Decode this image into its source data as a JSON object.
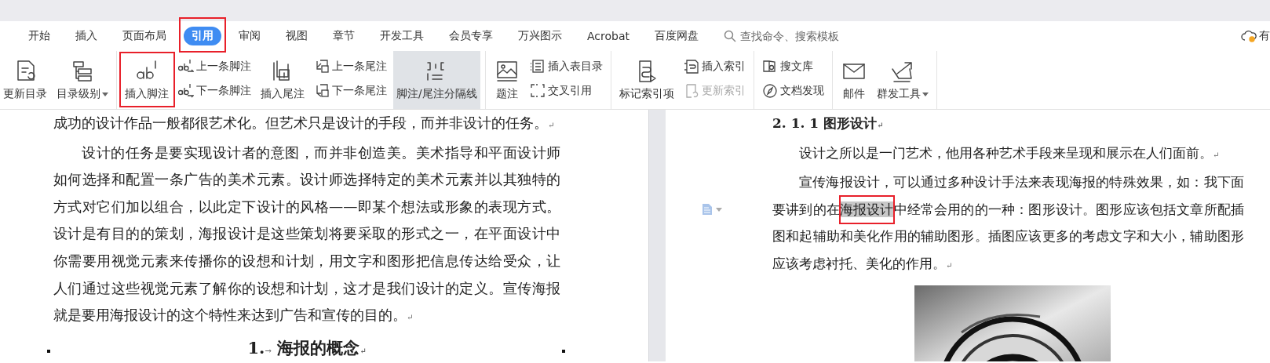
{
  "menu": {
    "tabs": [
      {
        "label": "开始",
        "selected": false,
        "annotated": false
      },
      {
        "label": "插入",
        "selected": false,
        "annotated": false
      },
      {
        "label": "页面布局",
        "selected": false,
        "annotated": false
      },
      {
        "label": "引用",
        "selected": true,
        "annotated": true
      },
      {
        "label": "审阅",
        "selected": false,
        "annotated": false
      },
      {
        "label": "视图",
        "selected": false,
        "annotated": false
      },
      {
        "label": "章节",
        "selected": false,
        "annotated": false
      },
      {
        "label": "开发工具",
        "selected": false,
        "annotated": false
      },
      {
        "label": "会员专享",
        "selected": false,
        "annotated": false
      },
      {
        "label": "万兴图示",
        "selected": false,
        "annotated": false
      },
      {
        "label": "Acrobat",
        "selected": false,
        "annotated": false
      },
      {
        "label": "百度网盘",
        "selected": false,
        "annotated": false
      }
    ],
    "search": {
      "placeholder": "查找命令、搜索模板"
    },
    "account": {
      "label": "有"
    }
  },
  "ribbon": {
    "groups": [
      {
        "items": [
          {
            "kind": "large",
            "label": "更新目录",
            "dropdown": false,
            "annotated": false,
            "hovered": false
          },
          {
            "kind": "large",
            "label": "目录级别",
            "dropdown": true,
            "annotated": false,
            "hovered": false
          }
        ]
      },
      {
        "items": [
          {
            "kind": "large",
            "label": "插入脚注",
            "dropdown": false,
            "annotated": true,
            "hovered": false
          },
          {
            "kind": "pair",
            "items": [
              {
                "label": "上一条脚注",
                "disabled": false
              },
              {
                "label": "下一条脚注",
                "disabled": false
              }
            ]
          },
          {
            "kind": "large",
            "label": "插入尾注",
            "dropdown": false,
            "annotated": false,
            "hovered": false
          },
          {
            "kind": "pair",
            "items": [
              {
                "label": "上一条尾注",
                "disabled": false
              },
              {
                "label": "下一条尾注",
                "disabled": false
              }
            ]
          },
          {
            "kind": "large",
            "label": "脚注/尾注分隔线",
            "dropdown": false,
            "annotated": false,
            "hovered": true
          }
        ]
      },
      {
        "items": [
          {
            "kind": "large",
            "label": "题注",
            "dropdown": false,
            "annotated": false,
            "hovered": false
          },
          {
            "kind": "pair",
            "items": [
              {
                "label": "插入表目录",
                "disabled": false
              },
              {
                "label": "交叉引用",
                "disabled": false
              }
            ]
          }
        ]
      },
      {
        "items": [
          {
            "kind": "large",
            "label": "标记索引项",
            "dropdown": false,
            "annotated": false,
            "hovered": false
          },
          {
            "kind": "pair",
            "items": [
              {
                "label": "插入索引",
                "disabled": false
              },
              {
                "label": "更新索引",
                "disabled": true
              }
            ]
          }
        ]
      },
      {
        "items": [
          {
            "kind": "pair",
            "items": [
              {
                "label": "搜文库",
                "disabled": false
              },
              {
                "label": "文档发现",
                "disabled": false
              }
            ]
          }
        ]
      },
      {
        "items": [
          {
            "kind": "large",
            "label": "邮件",
            "dropdown": false,
            "annotated": false,
            "hovered": false
          },
          {
            "kind": "large",
            "label": "群发工具",
            "dropdown": true,
            "annotated": false,
            "hovered": false
          }
        ]
      }
    ]
  },
  "pages": [
    {
      "blocks": [
        {
          "kind": "body",
          "indent": false,
          "margin_icon": false,
          "text": "成功的设计作品一般都很艺术化。但艺术只是设计的手段，而并非设计的任务。",
          "end_mark": "↵"
        },
        {
          "kind": "body",
          "indent": true,
          "margin_icon": false,
          "text": "设计的任务是要实现设计者的意图，而并非创造美。美术指导和平面设计师如何选择和配置一条广告的美术元素。设计师选择特定的美术元素并以其独特的方式对它们加以组合，以此定下设计的风格——即某个想法或形象的表现方式。设计是有目的的策划，海报设计是这些策划将要采取的形式之一，在平面设计中你需要用视觉元素来传播你的设想和计划，用文字和图形把信息传达给受众，让人们通过这些视觉元素了解你的设想和计划，这才是我们设计的定义。宣传海报就是要用海报设计的这个特性来达到广告和宣传的目的。",
          "end_mark": "↵"
        },
        {
          "kind": "heading",
          "centered": true,
          "margin_marks": true,
          "number": "1.",
          "tab_mark": "→",
          "text": "海报的概念",
          "end_mark": "↵"
        }
      ]
    },
    {
      "blocks": [
        {
          "kind": "heading",
          "centered": false,
          "margin_marks": false,
          "number": "2. 1. 1",
          "text": "图形设计",
          "end_mark": "↵"
        },
        {
          "kind": "body",
          "indent": true,
          "margin_icon": false,
          "text": "设计之所以是一门艺术，他用各种艺术手段来呈现和展示在人们面前。",
          "end_mark": "↵"
        },
        {
          "kind": "body",
          "indent": true,
          "margin_icon": true,
          "text": "宣传海报设计，可以通过多种设计手法来表现海报的特殊效果，如：我下面要讲到的在",
          "selection": {
            "text": "海报设计",
            "annotated": true
          },
          "text_after": "中经常会用的的一种：图形设计。图形应该包括文章所配插图和起辅助和美化作用的辅助图形。插图应该更多的考虑文字和大小，辅助图形应该考虑衬托、美化的作用。",
          "end_mark": "↵"
        },
        {
          "kind": "picture"
        }
      ]
    }
  ]
}
